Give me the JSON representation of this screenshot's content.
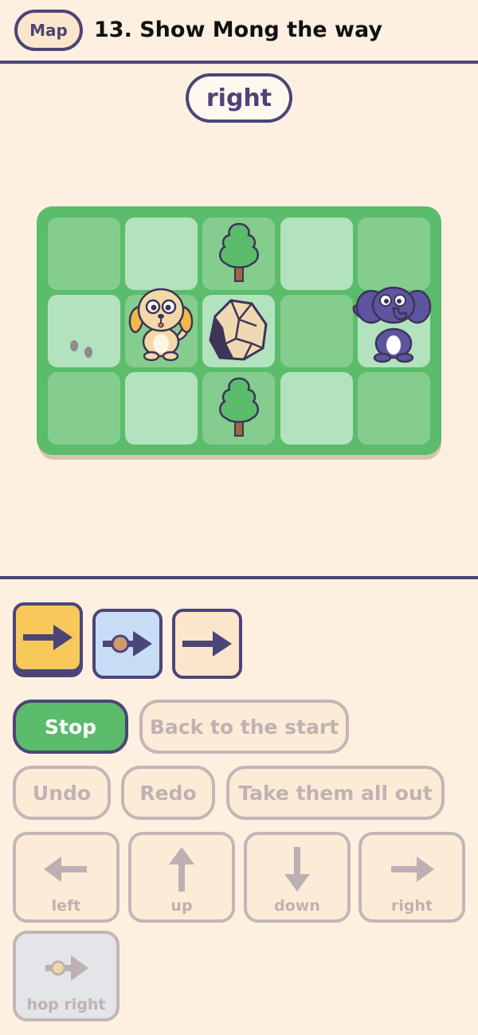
{
  "header": {
    "map_label": "Map",
    "title": "13. Show Mong the way"
  },
  "current_command": "right",
  "board": {
    "rows": 3,
    "cols": 5,
    "cells": [
      [
        "dark",
        "light",
        "dark",
        "light",
        "dark"
      ],
      [
        "light",
        "dark",
        "light",
        "dark",
        "light"
      ],
      [
        "dark",
        "light",
        "dark",
        "light",
        "dark"
      ]
    ],
    "objects": [
      {
        "name": "tree",
        "row": 0,
        "col": 2
      },
      {
        "name": "footprints",
        "row": 1,
        "col": 0
      },
      {
        "name": "dog-character",
        "row": 1,
        "col": 1
      },
      {
        "name": "rock",
        "row": 1,
        "col": 2
      },
      {
        "name": "mong-elephant",
        "row": 1,
        "col": 4
      },
      {
        "name": "tree",
        "row": 2,
        "col": 2
      }
    ]
  },
  "program": [
    {
      "icon": "right-arrow-icon",
      "color": "#F8C85B",
      "active": true
    },
    {
      "icon": "hop-right-icon",
      "color": "#C8DCF5",
      "active": false
    },
    {
      "icon": "right-arrow-icon",
      "color": "#FCE6CB",
      "active": false
    }
  ],
  "controls": {
    "stop": "Stop",
    "back_to_start": "Back to the start",
    "undo": "Undo",
    "redo": "Redo",
    "take_all_out": "Take them all out"
  },
  "direction_buttons": {
    "left": "left",
    "up": "up",
    "down": "down",
    "right": "right",
    "hop_right": "hop right"
  },
  "colors": {
    "accent": "#4B4578",
    "grass": "#5BBC6B",
    "background": "#FDF0E1"
  }
}
